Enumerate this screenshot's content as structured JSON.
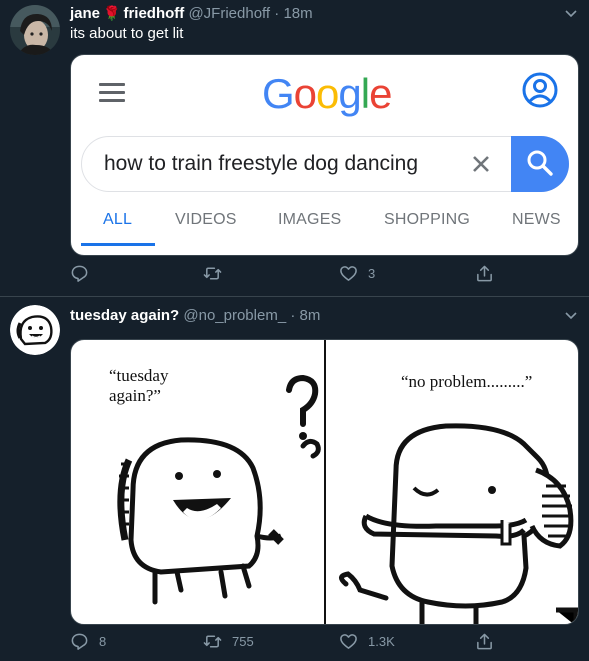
{
  "tweet1": {
    "name_first": "jane",
    "name_emoji": "🌹",
    "name_last": "friedhoff",
    "handle": "@JFriedhoff",
    "separator": "·",
    "time": "18m",
    "text": "its about to get lit",
    "google": {
      "logo": {
        "g1": "G",
        "o1": "o",
        "o2": "o",
        "g2": "g",
        "l": "l",
        "e": "e"
      },
      "query": "how to train freestyle dog dancing",
      "tabs": [
        "ALL",
        "VIDEOS",
        "IMAGES",
        "SHOPPING",
        "NEWS"
      ]
    },
    "actions": {
      "replies": "",
      "retweets": "",
      "likes": "3"
    }
  },
  "tweet2": {
    "name": "tuesday again?",
    "handle": "@no_problem_",
    "separator": "·",
    "time": "8m",
    "comic": {
      "caption_left_line1": "“tuesday",
      "caption_left_line2": "again?”",
      "caption_right": "“no problem.........”"
    },
    "actions": {
      "replies": "8",
      "retweets": "755",
      "likes": "1.3K"
    }
  },
  "colors": {
    "background": "#15202b",
    "secondary_text": "#8899a6",
    "divider": "#38444d",
    "google_blue": "#4285f4",
    "google_red": "#ea4335",
    "google_yellow": "#fbbc05",
    "google_green": "#34a853"
  },
  "icons": [
    "chevron-down-icon",
    "rose-emoji-icon",
    "hamburger-menu-icon",
    "account-circle-icon",
    "clear-icon",
    "search-icon",
    "reply-icon",
    "retweet-icon",
    "like-icon",
    "share-icon"
  ]
}
